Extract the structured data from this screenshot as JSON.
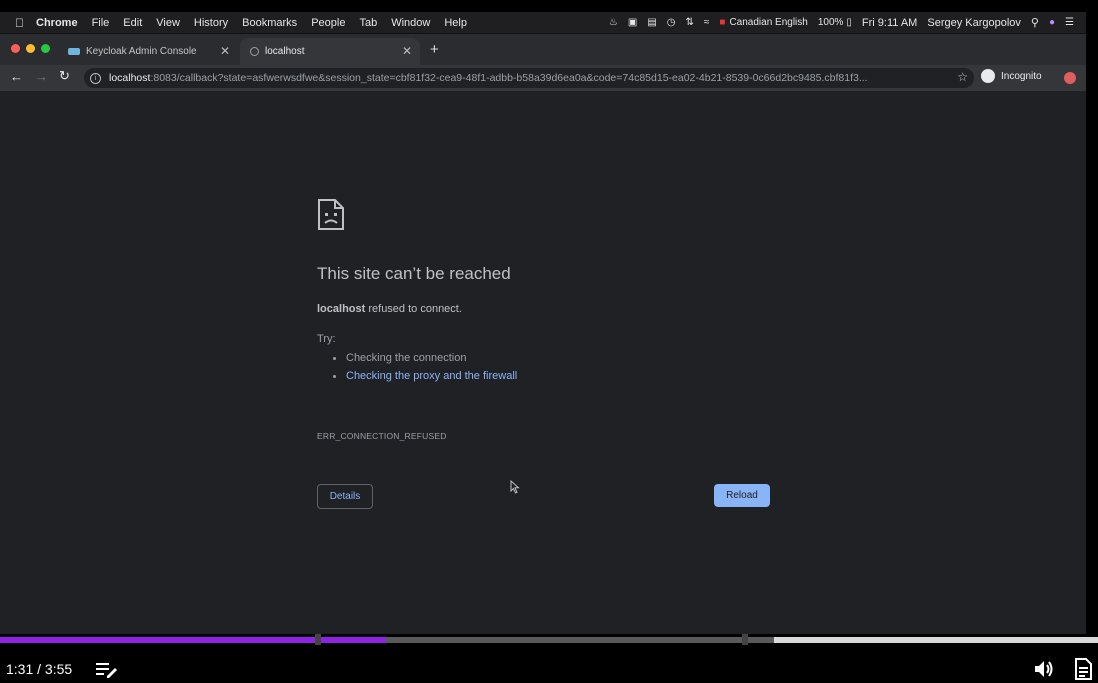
{
  "menubar": {
    "app": "Chrome",
    "items": [
      "File",
      "Edit",
      "View",
      "History",
      "Bookmarks",
      "People",
      "Tab",
      "Window",
      "Help"
    ],
    "input_source": "Canadian English",
    "battery": "100%",
    "clock": "Fri 9:11 AM",
    "user": "Sergey Kargopolov"
  },
  "tabs": [
    {
      "label": "Keycloak Admin Console",
      "icon": "keycloak-icon",
      "active": false
    },
    {
      "label": "localhost",
      "icon": "globe-icon",
      "active": true
    }
  ],
  "omnibox": {
    "host": "localhost",
    "rest": ":8083/callback?state=asfwerwsdfwe&session_state=cbf81f32-cea9-48f1-adbb-b58a39d6ea0a&code=74c85d15-ea02-4b21-8539-0c66d2bc9485.cbf81f3..."
  },
  "profile": {
    "label": "Incognito"
  },
  "error_page": {
    "title": "This site can’t be reached",
    "host": "localhost",
    "desc_rest": " refused to connect.",
    "try_label": "Try:",
    "suggestions": [
      "Checking the connection",
      "Checking the proxy and the firewall"
    ],
    "code": "ERR_CONNECTION_REFUSED",
    "details_label": "Details",
    "reload_label": "Reload"
  },
  "player": {
    "time": "1:31 / 3:55",
    "played_fraction": 0.352,
    "buffered_fraction": 0.295
  },
  "colors": {
    "accent": "#8ab4f8",
    "progress": "#8f22e4"
  }
}
